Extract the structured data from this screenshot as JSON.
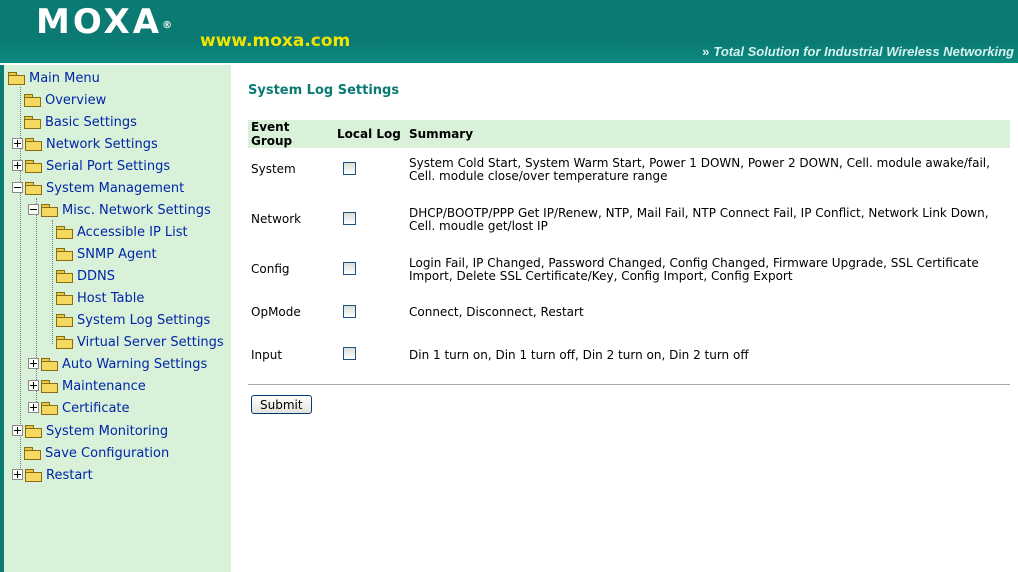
{
  "header": {
    "logo": "MOXA",
    "registered_mark": "®",
    "url": "www.moxa.com",
    "tagline_arrow": "»",
    "tagline": "Total Solution for Industrial Wireless Networking",
    "colors": {
      "band": "#0a7a72",
      "url": "#f1e400"
    }
  },
  "sidebar": {
    "items": [
      {
        "label": "Main Menu",
        "icon": "open-folder-icon"
      },
      {
        "label": "Overview",
        "icon": "folder-icon"
      },
      {
        "label": "Basic Settings",
        "icon": "folder-icon"
      },
      {
        "label": "Network Settings",
        "icon": "folder-icon",
        "expander": "plus"
      },
      {
        "label": "Serial Port Settings",
        "icon": "folder-icon",
        "expander": "plus"
      },
      {
        "label": "System Management",
        "icon": "open-folder-icon",
        "expander": "minus"
      },
      {
        "label": "Misc. Network Settings",
        "icon": "open-folder-icon",
        "expander": "minus"
      },
      {
        "label": "Accessible IP List",
        "icon": "folder-icon"
      },
      {
        "label": "SNMP Agent",
        "icon": "folder-icon"
      },
      {
        "label": "DDNS",
        "icon": "folder-icon"
      },
      {
        "label": "Host Table",
        "icon": "folder-icon"
      },
      {
        "label": "System Log Settings",
        "icon": "folder-icon"
      },
      {
        "label": "Virtual Server Settings",
        "icon": "folder-icon"
      },
      {
        "label": "Auto Warning Settings",
        "icon": "folder-icon",
        "expander": "plus"
      },
      {
        "label": "Maintenance",
        "icon": "folder-icon",
        "expander": "plus"
      },
      {
        "label": "Certificate",
        "icon": "folder-icon",
        "expander": "plus"
      },
      {
        "label": "System Monitoring",
        "icon": "folder-icon",
        "expander": "plus"
      },
      {
        "label": "Save Configuration",
        "icon": "folder-icon"
      },
      {
        "label": "Restart",
        "icon": "folder-icon",
        "expander": "plus"
      }
    ]
  },
  "main": {
    "title": "System Log Settings",
    "table": {
      "headers": [
        "Event Group",
        "Local Log",
        "Summary"
      ],
      "rows": [
        {
          "group": "System",
          "checked": false,
          "summary": "System Cold Start, System Warm Start, Power 1 DOWN, Power 2 DOWN, Cell. module awake/fail, Cell. module close/over temperature range"
        },
        {
          "group": "Network",
          "checked": false,
          "summary": "DHCP/BOOTP/PPP Get IP/Renew, NTP, Mail Fail, NTP Connect Fail, IP Conflict, Network Link Down, Cell. moudle get/lost IP"
        },
        {
          "group": "Config",
          "checked": false,
          "summary": "Login Fail, IP Changed, Password Changed, Config Changed, Firmware Upgrade, SSL Certificate Import, Delete SSL Certificate/Key, Config Import, Config Export"
        },
        {
          "group": "OpMode",
          "checked": false,
          "summary": "Connect, Disconnect, Restart"
        },
        {
          "group": "Input",
          "checked": false,
          "summary": "Din 1 turn on, Din 1 turn off, Din 2 turn on, Din 2 turn off"
        }
      ]
    },
    "submit_label": "Submit"
  }
}
